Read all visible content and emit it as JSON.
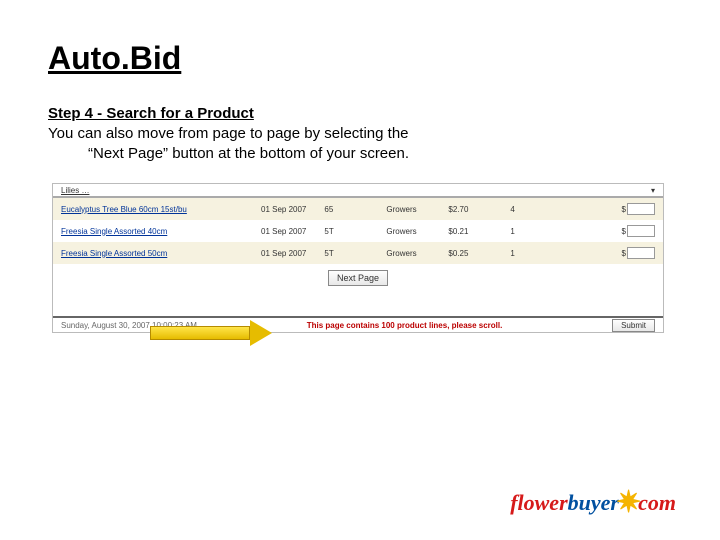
{
  "title": "Auto.Bid",
  "step": {
    "heading": "Step 4 - Search for a Product",
    "line1": "You can also move from page to page by selecting the",
    "line2": "“Next Page” button at the bottom of your screen."
  },
  "table": {
    "partial_name": "Lilies …",
    "rows": [
      {
        "name": "Eucalyptus Tree Blue 60cm 15st/bu",
        "date": "01 Sep 2007",
        "qty": "65",
        "grade": "Growers",
        "price": "$2.70",
        "units": "4"
      },
      {
        "name": "Freesia Single Assorted 40cm",
        "date": "01 Sep 2007",
        "qty": "5T",
        "grade": "Growers",
        "price": "$0.21",
        "units": "1"
      },
      {
        "name": "Freesia Single Assorted 50cm",
        "date": "01 Sep 2007",
        "qty": "5T",
        "grade": "Growers",
        "price": "$0.25",
        "units": "1"
      }
    ]
  },
  "next_page_label": "Next Page",
  "status": {
    "timestamp": "Sunday, August 30, 2007  10:00:23 AM",
    "message": "This page contains 100 product lines, please scroll.",
    "submit": "Submit"
  },
  "logo": {
    "flower": "flower",
    "buyer": "buyer",
    "com": "com"
  }
}
